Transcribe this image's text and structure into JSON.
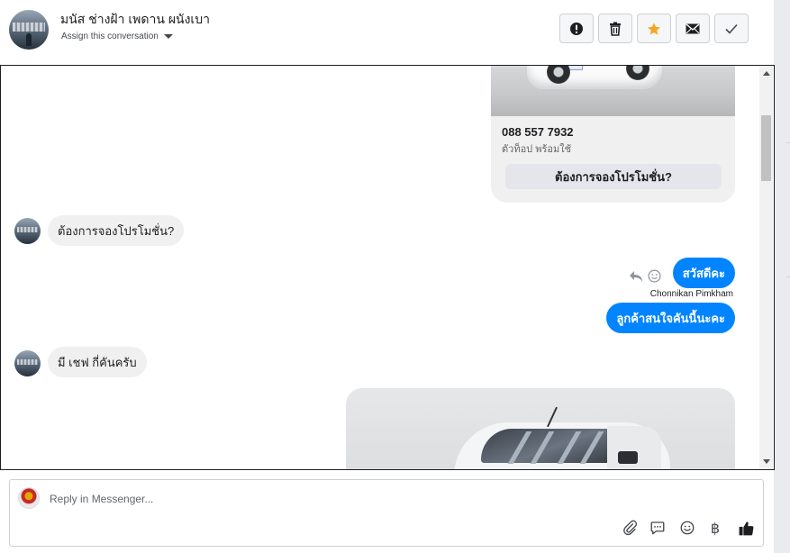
{
  "header": {
    "contact_name": "มนัส ช่างฝ้า เพดาน ผนังเบา",
    "assign_label": "Assign this conversation",
    "actions": [
      {
        "name": "spam",
        "icon": "exclamation-circle-icon"
      },
      {
        "name": "delete",
        "icon": "trash-icon"
      },
      {
        "name": "star",
        "icon": "star-icon",
        "color": "#f5a623"
      },
      {
        "name": "mark-unread",
        "icon": "envelope-icon"
      },
      {
        "name": "done",
        "icon": "check-icon"
      }
    ]
  },
  "conversation": {
    "card": {
      "phone": "088 557 7932",
      "subtitle": "ตัวท็อป พร้อมใช้",
      "button_label": "ต้องการจองโปรโมชั่น?"
    },
    "messages": [
      {
        "direction": "incoming",
        "text": "ต้องการจองโปรโมชั่น?"
      },
      {
        "direction": "outgoing",
        "text": "สวัสดีคะ",
        "sender": "Chonnikan Pimkham"
      },
      {
        "direction": "outgoing",
        "text": "ลูกค้าสนใจคันนี้นะคะ"
      },
      {
        "direction": "incoming",
        "text": "มี เชฟ กี่คันครับ"
      }
    ]
  },
  "composer": {
    "placeholder": "Reply in Messenger...",
    "icons": [
      "paperclip-icon",
      "saved-reply-icon",
      "emoji-icon",
      "baht-icon",
      "thumbs-up-icon"
    ],
    "baht_symbol": "฿"
  },
  "colors": {
    "messenger_blue": "#0084ff",
    "incoming_bubble": "#f0f0f0",
    "star_orange": "#f5a623"
  }
}
